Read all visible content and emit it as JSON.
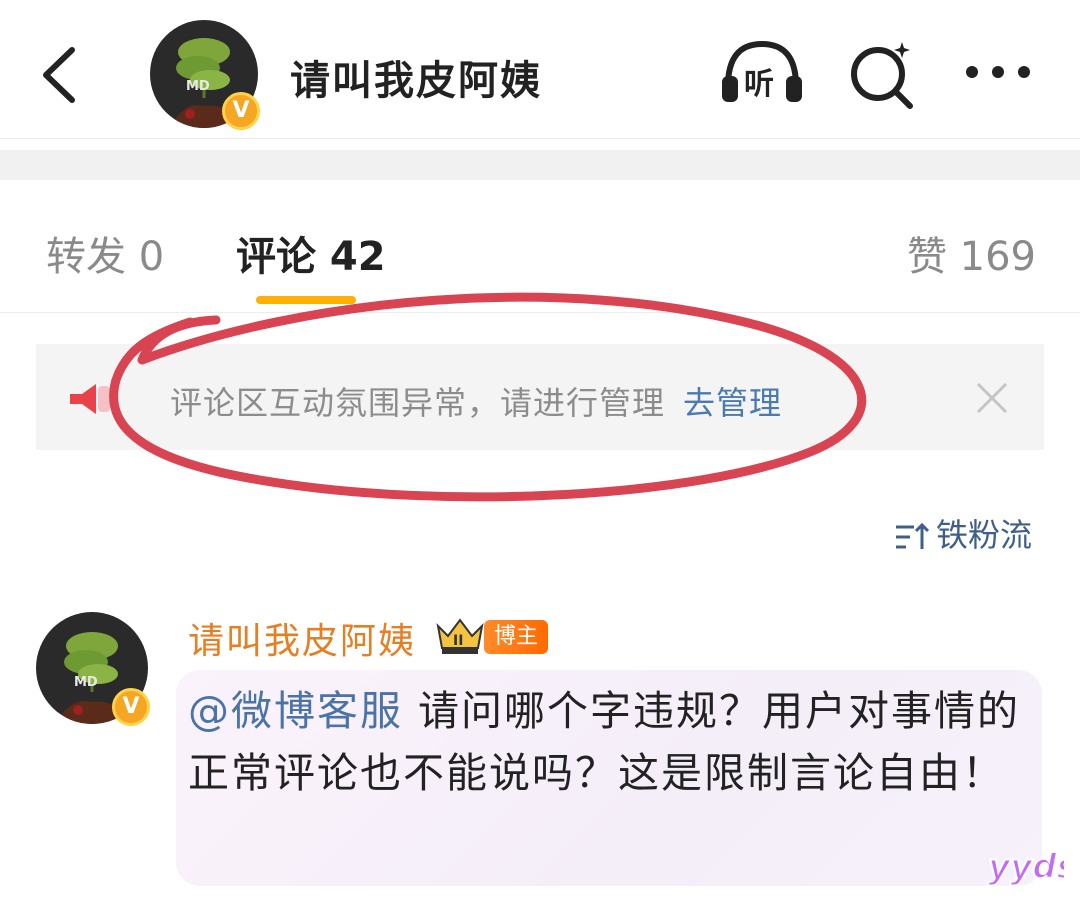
{
  "header": {
    "title": "请叫我皮阿姨",
    "avatar_badge": "V",
    "avatar_text": "MD",
    "listen_label": "听",
    "icons": [
      "back-icon",
      "listen-icon",
      "search-icon",
      "more-icon"
    ]
  },
  "tabs": [
    {
      "label": "转发 0",
      "active": false
    },
    {
      "label": "评论 42",
      "active": true
    },
    {
      "label": "赞 169",
      "active": false
    }
  ],
  "notice": {
    "text": "评论区互动氛围异常，请进行管理",
    "link": "去管理"
  },
  "sort": {
    "label": "铁粉流"
  },
  "comment": {
    "author": "请叫我皮阿姨",
    "host_tag": "博主",
    "level_badge": "II",
    "mention": "@微博客服",
    "text": " 请问哪个字违规？用户对事情的正常评论也不能说吗？这是限制言论自由！",
    "sticker_text": "yyds"
  },
  "colors": {
    "accent_orange": "#ffb000",
    "author_orange": "#e67e22",
    "link_blue": "#4a7ab0",
    "annotation_red": "#d94452"
  }
}
